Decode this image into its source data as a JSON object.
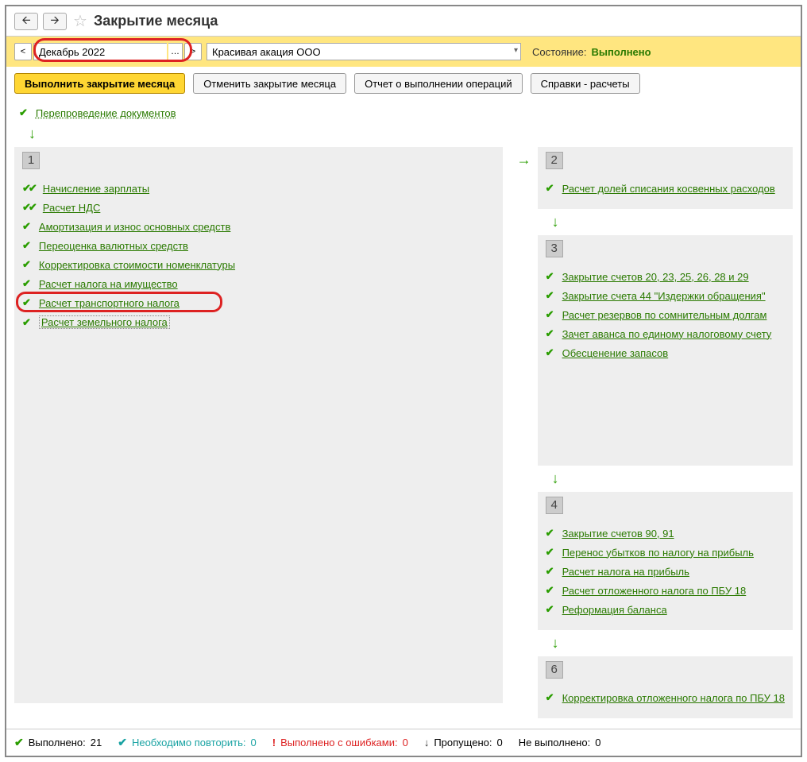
{
  "title": "Закрытие месяца",
  "period": "Декабрь 2022",
  "organization": "Красивая акация ООО",
  "status_label": "Состояние:",
  "status_value": "Выполнено",
  "buttons": {
    "execute": "Выполнить закрытие месяца",
    "cancel": "Отменить закрытие месяца",
    "report": "Отчет о выполнении операций",
    "refs": "Справки - расчеты"
  },
  "pre_op": "Перепроведение документов",
  "col1": {
    "num": "1",
    "ops": [
      {
        "label": "Начисление зарплаты",
        "dbl": true
      },
      {
        "label": "Расчет НДС",
        "dbl": true
      },
      {
        "label": "Амортизация и износ основных средств",
        "dbl": false
      },
      {
        "label": "Переоценка валютных средств",
        "dbl": false
      },
      {
        "label": "Корректировка стоимости номенклатуры",
        "dbl": false
      },
      {
        "label": "Расчет налога на имущество",
        "dbl": false
      },
      {
        "label": "Расчет транспортного налога",
        "dbl": false,
        "circled": true
      },
      {
        "label": "Расчет земельного налога",
        "dbl": false,
        "dotted": true
      }
    ]
  },
  "col2": {
    "b2": {
      "num": "2",
      "ops": [
        "Расчет долей списания косвенных расходов"
      ]
    },
    "b3": {
      "num": "3",
      "ops": [
        "Закрытие счетов 20, 23, 25, 26, 28 и 29",
        "Закрытие счета 44 \"Издержки обращения\"",
        "Расчет резервов по сомнительным долгам",
        "Зачет аванса по единому налоговому счету",
        "Обесценение запасов"
      ]
    },
    "b4": {
      "num": "4",
      "ops": [
        "Закрытие счетов 90, 91",
        "Перенос убытков по налогу на прибыль",
        "Расчет налога на прибыль",
        "Расчет отложенного налога по ПБУ 18",
        "Реформация баланса"
      ]
    },
    "b6": {
      "num": "6",
      "ops": [
        "Корректировка отложенного налога по ПБУ 18"
      ]
    }
  },
  "status": {
    "done_label": "Выполнено:",
    "done_val": "21",
    "repeat_label": "Необходимо повторить:",
    "repeat_val": "0",
    "err_label": "Выполнено с ошибками:",
    "err_val": "0",
    "skip_label": "Пропущено:",
    "skip_val": "0",
    "notdone_label": "Не выполнено:",
    "notdone_val": "0"
  }
}
